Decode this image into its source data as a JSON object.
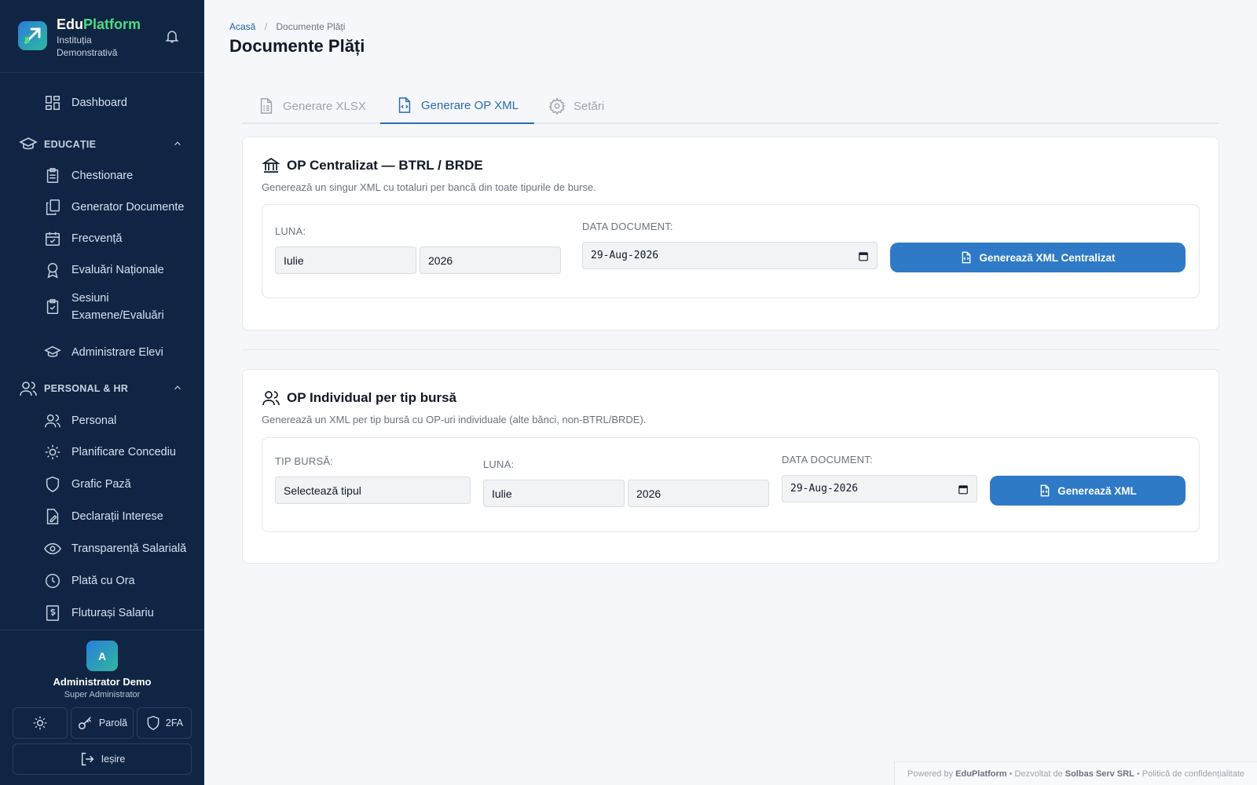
{
  "brand": {
    "name_a": "Edu",
    "name_b": "Platform",
    "institution": "Instituția Demonstrativă"
  },
  "sidebar": {
    "dashboard": "Dashboard",
    "sections": [
      {
        "title": "EDUCAȚIE",
        "items": [
          "Chestionare",
          "Generator Documente",
          "Frecvență",
          "Evaluări Naționale",
          "Sesiuni Examene/Evaluări",
          "Administrare Elevi"
        ]
      },
      {
        "title": "PERSONAL & HR",
        "items": [
          "Personal",
          "Planificare Concediu",
          "Grafic Pază",
          "Declarații Interese",
          "Transparență Salarială",
          "Plată cu Ora",
          "Fluturași Salariu"
        ]
      }
    ],
    "user": {
      "initial": "A",
      "name": "Administrator Demo",
      "role": "Super Administrator"
    },
    "buttons": {
      "password": "Parolă",
      "twofa": "2FA",
      "logout": "Ieșire"
    }
  },
  "breadcrumb": {
    "home": "Acasă",
    "sep": "/",
    "current": "Documente Plăți"
  },
  "page_title": "Documente Plăți",
  "tabs": [
    {
      "label": "Generare XLSX",
      "icon": "spreadsheet-icon"
    },
    {
      "label": "Generare OP XML",
      "icon": "code-file-icon"
    },
    {
      "label": "Setări",
      "icon": "gear-icon"
    }
  ],
  "centralized": {
    "title": "OP Centralizat — BTRL / BRDE",
    "description": "Generează un singur XML cu totaluri per bancă din toate tipurile de burse.",
    "month_label": "LUNA:",
    "month": "Iulie",
    "year": "2026",
    "date_label": "DATA DOCUMENT:",
    "date": "29-Aug-2026",
    "button": "Generează XML Centralizat"
  },
  "individual": {
    "title": "OP Individual per tip bursă",
    "description": "Generează un XML per tip bursă cu OP-uri individuale (alte bănci, non-BTRL/BRDE).",
    "type_label": "TIP BURSĂ:",
    "type_placeholder": "Selectează tipul",
    "month_label": "LUNA:",
    "month": "Iulie",
    "year": "2026",
    "date_label": "DATA DOCUMENT:",
    "date": "29-Aug-2026",
    "button": "Generează XML"
  },
  "footer": {
    "powered": "Powered by",
    "brand": "EduPlatform",
    "dev": "• Dezvoltat de",
    "company": "Solbas Serv SRL",
    "privacy": "• Politică de confidențialitate"
  },
  "colors": {
    "sidebar": "#102544",
    "accent": "#2f7ac6",
    "brand_green": "#4ade80"
  }
}
